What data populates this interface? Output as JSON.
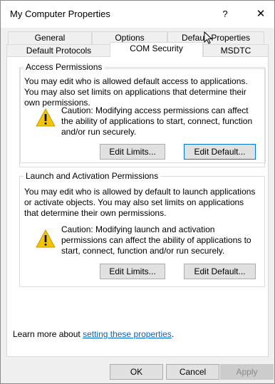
{
  "window": {
    "title": "My Computer Properties",
    "help_label": "?",
    "close_label": "✕"
  },
  "tabs": {
    "row1": [
      "General",
      "Options",
      "Default Properties"
    ],
    "row2": [
      "Default Protocols",
      "COM Security",
      "MSDTC"
    ],
    "active": "COM Security"
  },
  "access": {
    "title": "Access Permissions",
    "description": "You may edit who is allowed default access to applications. You may also set limits on applications that determine their own permissions.",
    "caution": "Caution: Modifying access permissions can affect the ability of applications to start, connect, function and/or run securely.",
    "edit_limits": "Edit Limits...",
    "edit_default": "Edit Default..."
  },
  "launch": {
    "title": "Launch and Activation Permissions",
    "description": "You may edit who is allowed by default to launch applications or activate objects. You may also set limits on applications that determine their own permissions.",
    "caution": "Caution: Modifying launch and activation permissions can affect the ability of applications to start, connect, function and/or run securely.",
    "edit_limits": "Edit Limits...",
    "edit_default": "Edit Default..."
  },
  "learn_more": {
    "prefix": "Learn more about ",
    "link": "setting these properties",
    "suffix": "."
  },
  "footer": {
    "ok": "OK",
    "cancel": "Cancel",
    "apply": "Apply"
  },
  "colors": {
    "link": "#0066cc",
    "focus_border": "#0078d7",
    "warning": "#f5c400"
  }
}
